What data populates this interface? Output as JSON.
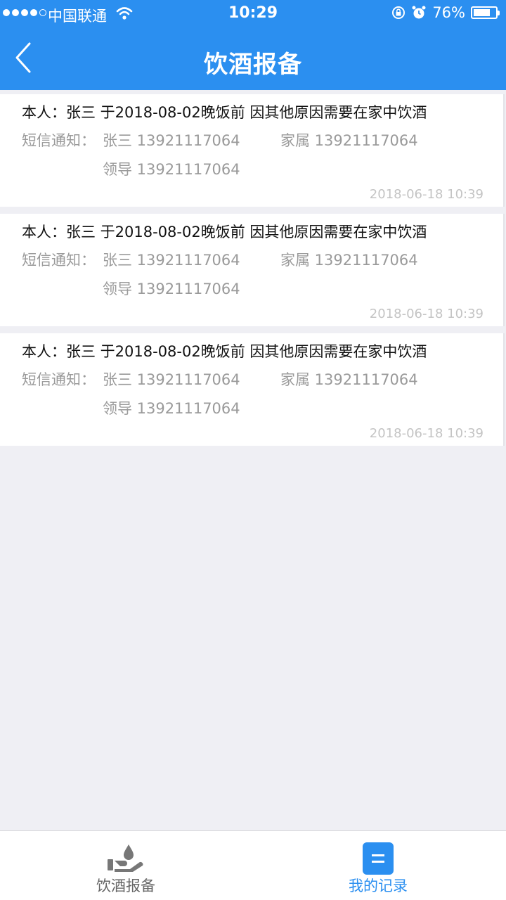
{
  "status_bar": {
    "carrier": "中国联通",
    "time": "10:29",
    "battery": "76%",
    "battery_level": 0.76
  },
  "nav": {
    "title": "饮酒报备"
  },
  "records": [
    {
      "line1": "本人：张三 于2018-08-02晚饭前 因其他原因需要在家中饮酒",
      "sms_label": "短信通知：",
      "sms_self": "张三 13921117064",
      "sms_family": "家属 13921117064",
      "sms_leader": "领导 13921117064",
      "timestamp": "2018-06-18  10:39"
    },
    {
      "line1": "本人：张三 于2018-08-02晚饭前 因其他原因需要在家中饮酒",
      "sms_label": "短信通知：",
      "sms_self": "张三 13921117064",
      "sms_family": "家属 13921117064",
      "sms_leader": "领导 13921117064",
      "timestamp": "2018-06-18  10:39"
    },
    {
      "line1": "本人：张三 于2018-08-02晚饭前 因其他原因需要在家中饮酒",
      "sms_label": "短信通知：",
      "sms_self": "张三 13921117064",
      "sms_family": "家属 13921117064",
      "sms_leader": "领导 13921117064",
      "timestamp": "2018-06-18  10:39"
    }
  ],
  "tabbar": {
    "tabs": [
      {
        "label": "饮酒报备",
        "icon": "hand-drop-icon",
        "active": false
      },
      {
        "label": "我的记录",
        "icon": "records-icon",
        "active": true
      }
    ],
    "active_color": "#2b8ff0",
    "inactive_color": "#666666"
  },
  "colors": {
    "primary": "#2b8ff0",
    "background": "#efeff4"
  }
}
